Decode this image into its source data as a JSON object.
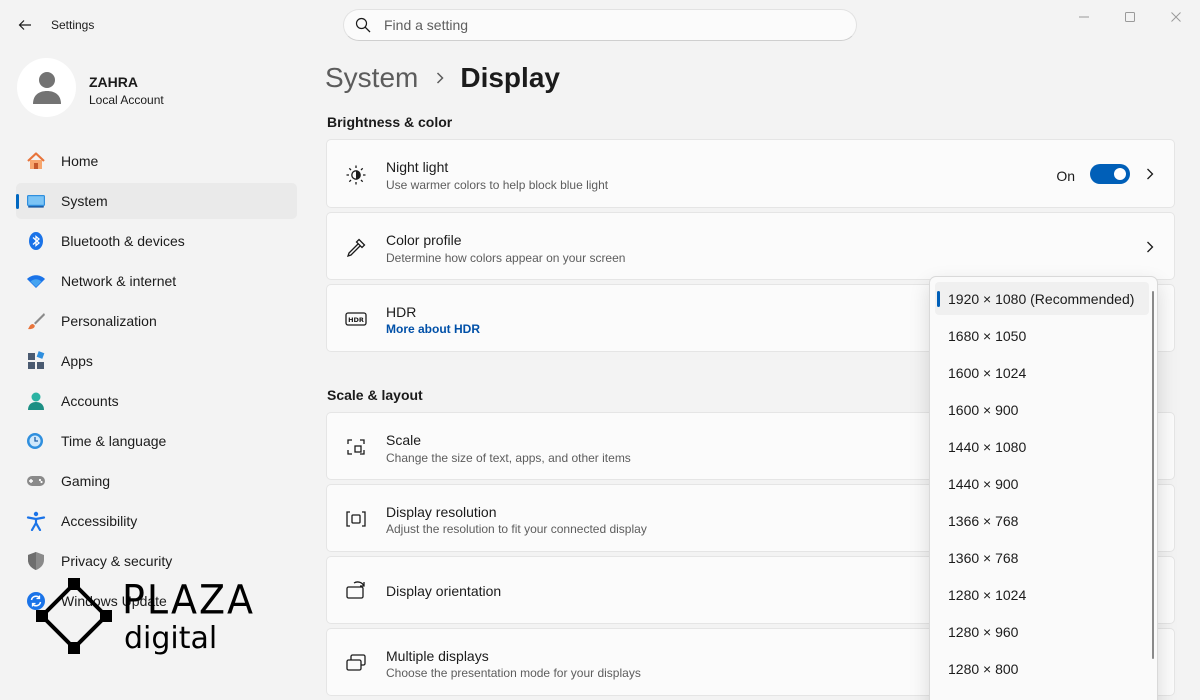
{
  "app": {
    "title": "Settings"
  },
  "search": {
    "placeholder": "Find a setting"
  },
  "profile": {
    "name": "ZAHRA",
    "account_type": "Local Account"
  },
  "sidebar": {
    "items": [
      {
        "label": "Home",
        "icon": "home-icon"
      },
      {
        "label": "System",
        "icon": "system-icon",
        "active": true
      },
      {
        "label": "Bluetooth & devices",
        "icon": "bluetooth-icon"
      },
      {
        "label": "Network & internet",
        "icon": "wifi-icon"
      },
      {
        "label": "Personalization",
        "icon": "brush-icon"
      },
      {
        "label": "Apps",
        "icon": "apps-icon"
      },
      {
        "label": "Accounts",
        "icon": "accounts-icon"
      },
      {
        "label": "Time & language",
        "icon": "clock-globe-icon"
      },
      {
        "label": "Gaming",
        "icon": "gamepad-icon"
      },
      {
        "label": "Accessibility",
        "icon": "accessibility-icon"
      },
      {
        "label": "Privacy & security",
        "icon": "shield-icon"
      },
      {
        "label": "Windows Update",
        "icon": "update-icon"
      }
    ]
  },
  "breadcrumb": {
    "parent": "System",
    "current": "Display"
  },
  "sections": {
    "brightness": {
      "title": "Brightness & color",
      "night_light": {
        "title": "Night light",
        "desc": "Use warmer colors to help block blue light",
        "toggle_label": "On",
        "toggle_on": true
      },
      "color_profile": {
        "title": "Color profile",
        "desc": "Determine how colors appear on your screen"
      },
      "hdr": {
        "title": "HDR",
        "link": "More about HDR"
      }
    },
    "scale_layout": {
      "title": "Scale & layout",
      "scale": {
        "title": "Scale",
        "desc": "Change the size of text, apps, and other items"
      },
      "resolution": {
        "title": "Display resolution",
        "desc": "Adjust the resolution to fit your connected display"
      },
      "orientation": {
        "title": "Display orientation"
      },
      "multiple": {
        "title": "Multiple displays",
        "desc": "Choose the presentation mode for your displays"
      }
    }
  },
  "resolution_dropdown": {
    "options": [
      "1920 × 1080 (Recommended)",
      "1680 × 1050",
      "1600 × 1024",
      "1600 × 900",
      "1440 × 1080",
      "1440 × 900",
      "1366 × 768",
      "1360 × 768",
      "1280 × 1024",
      "1280 × 960",
      "1280 × 800"
    ],
    "selected_index": 0
  },
  "watermark": {
    "line1": "PLAZA",
    "line2": "digital"
  },
  "colors": {
    "accent": "#005fb8",
    "background": "#f3f3f3",
    "card": "#fbfbfb"
  }
}
